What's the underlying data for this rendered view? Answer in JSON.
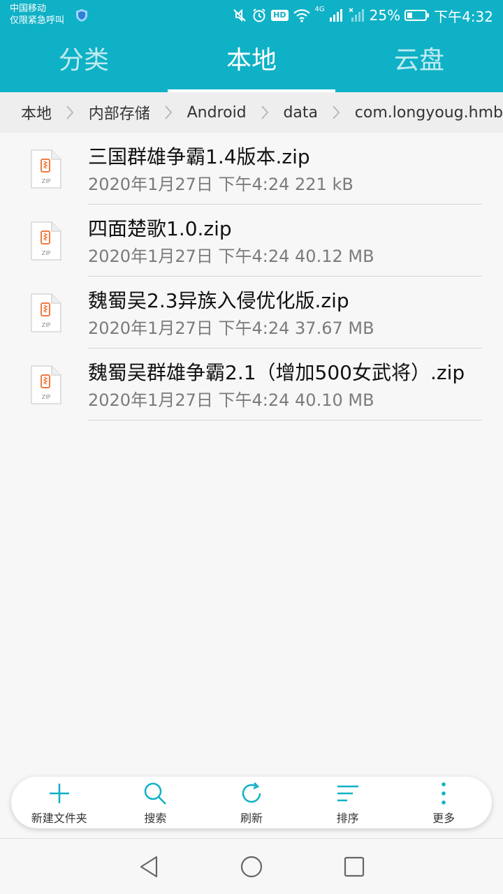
{
  "status_bar": {
    "carrier": "中国移动",
    "emergency": "仅限紧急呼叫",
    "hd_badge": "HD",
    "network_badge": "4G",
    "battery": "25%",
    "time": "下午4:32"
  },
  "tabs": [
    {
      "label": "分类",
      "active": false
    },
    {
      "label": "本地",
      "active": true
    },
    {
      "label": "云盘",
      "active": false
    }
  ],
  "breadcrumb": [
    "本地",
    "内部存储",
    "Android",
    "data",
    "com.longyoug.hmb"
  ],
  "files": [
    {
      "name": "三国群雄争霸1.4版本.zip",
      "meta": "2020年1月27日 下午4:24 221 kB",
      "icon": "zip-file-icon"
    },
    {
      "name": "四面楚歌1.0.zip",
      "meta": "2020年1月27日 下午4:24 40.12 MB",
      "icon": "zip-file-icon"
    },
    {
      "name": "魏蜀吴2.3异族入侵优化版.zip",
      "meta": "2020年1月27日 下午4:24 37.67 MB",
      "icon": "zip-file-icon"
    },
    {
      "name": "魏蜀吴群雄争霸2.1（增加500女武将）.zip",
      "meta": "2020年1月27日 下午4:24 40.10 MB",
      "icon": "zip-file-icon"
    }
  ],
  "file_icon_text": "ZIP",
  "toolbar": {
    "new_folder": "新建文件夹",
    "search": "搜索",
    "refresh": "刷新",
    "sort": "排序",
    "more": "更多"
  },
  "colors": {
    "accent": "#0fb1c6",
    "zip_orange": "#f07b3f"
  }
}
